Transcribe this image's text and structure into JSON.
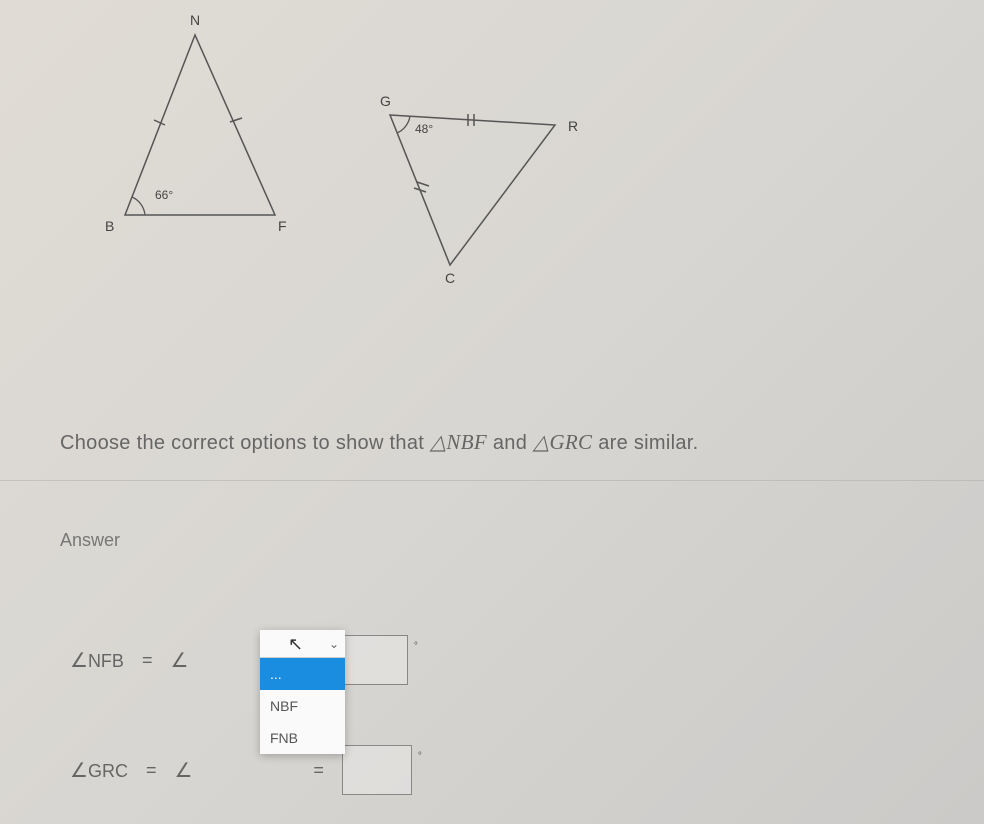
{
  "diagram": {
    "triangle1": {
      "vertices": {
        "top": "N",
        "left": "B",
        "right": "F"
      },
      "angle_label": "66°"
    },
    "triangle2": {
      "vertices": {
        "topleft": "G",
        "topright": "R",
        "bottom": "C"
      },
      "angle_label": "48°"
    }
  },
  "question": {
    "prefix": "Choose the correct options to show that ",
    "tri1": "△NBF",
    "mid": " and ",
    "tri2": "△GRC",
    "suffix": " are similar."
  },
  "answer": {
    "heading": "Answer",
    "row1": {
      "angle_prefix": "∠",
      "label": "NFB",
      "equals": "="
    },
    "row2": {
      "angle_prefix": "∠",
      "label": "GRC",
      "equals": "="
    },
    "angle_symbol": "∠"
  },
  "dropdown": {
    "placeholder": "...",
    "opt1": "NBF",
    "opt2": "FNB"
  }
}
